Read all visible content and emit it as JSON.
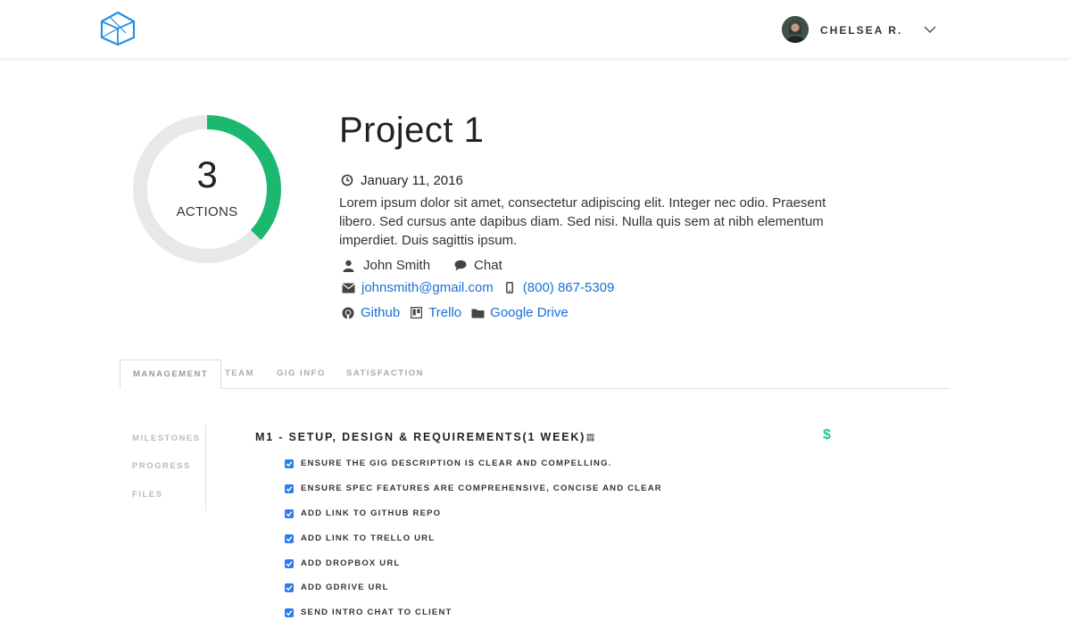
{
  "header": {
    "logo_icon": "cube-logo-icon",
    "user_name": "CHELSEA R.",
    "avatar_icon": "avatar",
    "menu_icon": "chevron-down-icon"
  },
  "summary": {
    "count": "3",
    "count_label": "ACTIONS",
    "progress_fraction": 0.37,
    "progress_color": "#1db870",
    "track_color": "#e8e8e8"
  },
  "project": {
    "title": "Project 1",
    "date": "January 11, 2016",
    "description": "Lorem ipsum dolor sit amet, consectetur adipiscing elit. Integer nec odio. Praesent libero. Sed cursus ante dapibus diam. Sed nisi. Nulla quis sem at nibh elementum imperdiet. Duis sagittis ipsum.",
    "contact_name": "John Smith",
    "chat_label": "Chat",
    "email": "johnsmith@gmail.com",
    "phone": "(800) 867-5309",
    "links": {
      "github": "Github",
      "trello": "Trello",
      "gdrive": "Google Drive"
    }
  },
  "tabs": [
    {
      "label": "MANAGEMENT"
    },
    {
      "label": "TEAM"
    },
    {
      "label": "GIG INFO"
    },
    {
      "label": "SATISFACTION"
    }
  ],
  "sidenav": [
    {
      "label": "MILESTONES"
    },
    {
      "label": "PROGRESS"
    },
    {
      "label": "FILES"
    }
  ],
  "milestone": {
    "title": "M1 - SETUP, DESIGN & REQUIREMENTS(1 WEEK)",
    "currency_symbol": "$",
    "tasks": [
      {
        "label": "ENSURE THE GIG DESCRIPTION IS CLEAR AND COMPELLING.",
        "checked": true
      },
      {
        "label": "ENSURE SPEC FEATURES ARE COMPREHENSIVE, CONCISE AND CLEAR",
        "checked": true
      },
      {
        "label": "ADD LINK TO GITHUB REPO",
        "checked": true
      },
      {
        "label": "ADD LINK TO TRELLO URL",
        "checked": true
      },
      {
        "label": "ADD DROPBOX URL",
        "checked": true
      },
      {
        "label": "ADD GDRIVE URL",
        "checked": true
      },
      {
        "label": "SEND INTRO CHAT TO CLIENT",
        "checked": true
      }
    ]
  },
  "colors": {
    "accent_blue": "#1a6fd6",
    "checkbox_blue": "#2d7cf0",
    "money_green": "#27c47b"
  }
}
